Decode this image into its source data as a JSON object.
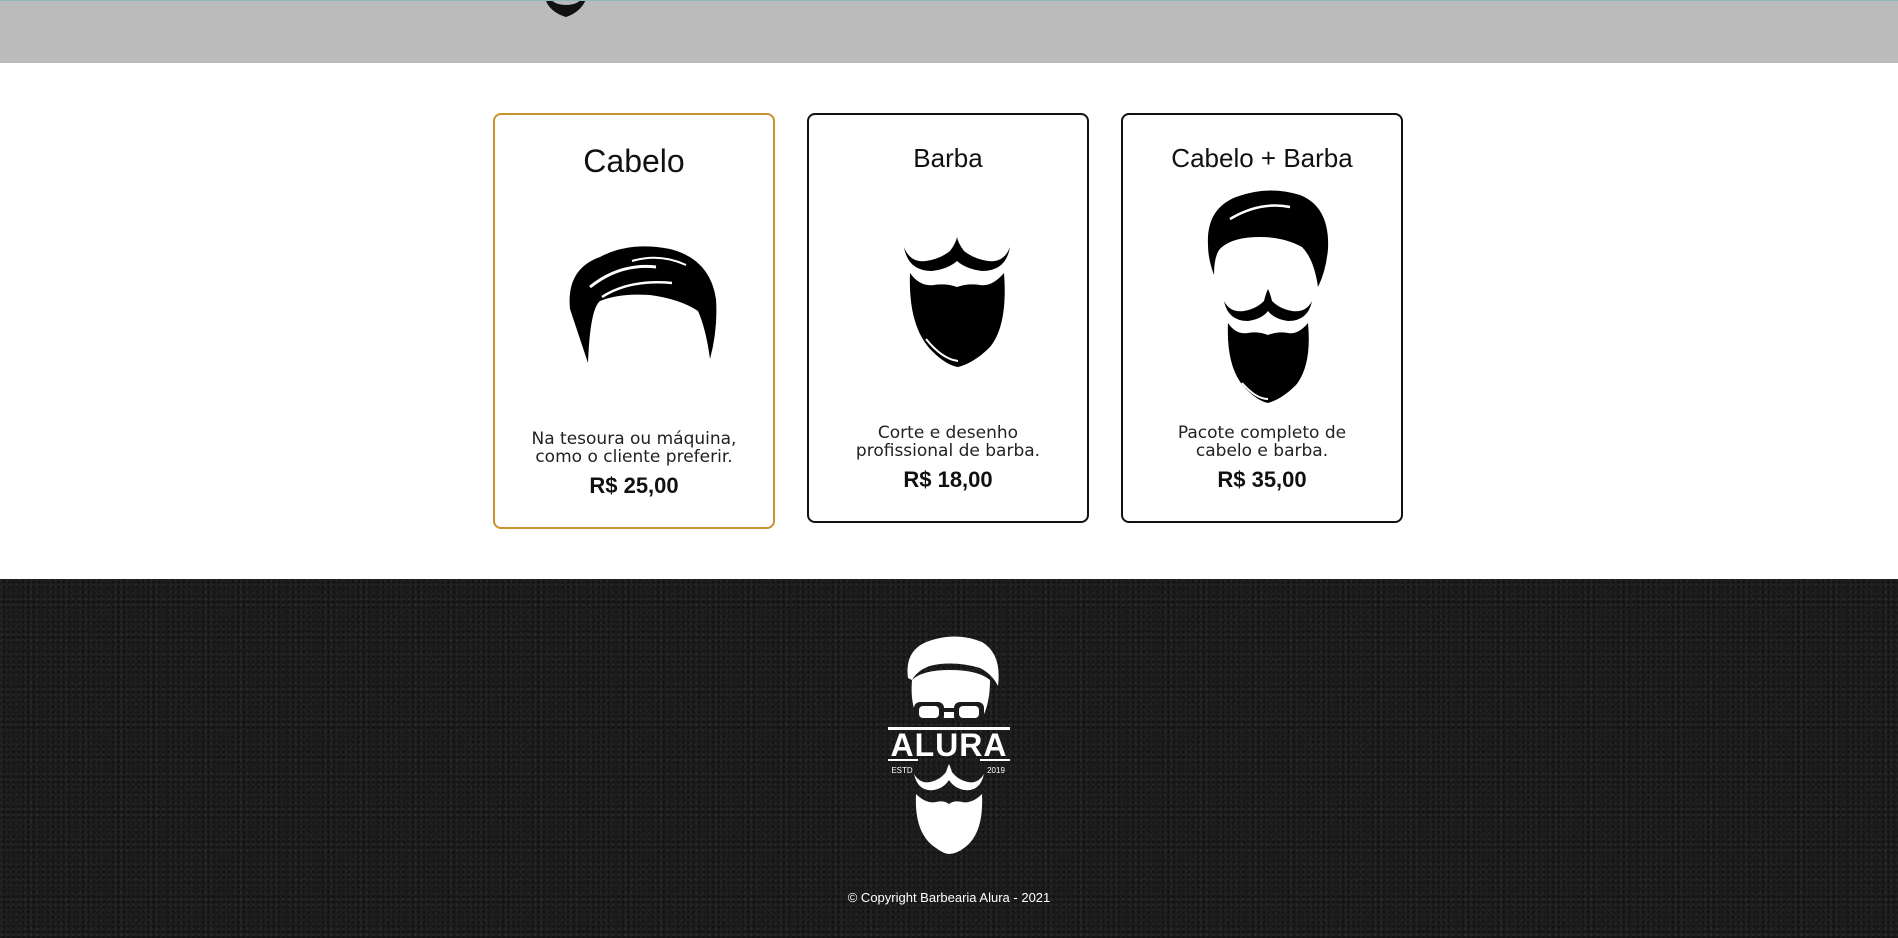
{
  "header": {
    "logo_icon": "alura-barber-logo-icon"
  },
  "services": [
    {
      "title": "Cabelo",
      "icon": "hair-icon",
      "description_line1": "Na tesoura ou máquina,",
      "description_line2": "como o cliente preferir.",
      "price": "R$ 25,00",
      "selected": true
    },
    {
      "title": "Barba",
      "icon": "beard-icon",
      "description_line1": "Corte e desenho",
      "description_line2": "profissional de barba.",
      "price": "R$ 18,00",
      "selected": false
    },
    {
      "title": "Cabelo + Barba",
      "icon": "hair-and-beard-icon",
      "description_line1": "Pacote completo de",
      "description_line2": "cabelo e barba.",
      "price": "R$ 35,00",
      "selected": false
    }
  ],
  "footer": {
    "logo": {
      "icon": "alura-barber-logo-icon",
      "brand": "ALURA",
      "estd_label": "ESTD",
      "year": "2019"
    },
    "copyright": "© Copyright Barbearia Alura - 2021"
  },
  "colors": {
    "header_bg": "#bbbbbb",
    "selected_border": "#c8922e",
    "card_border": "#111111",
    "footer_bg": "#1c1c1c"
  }
}
